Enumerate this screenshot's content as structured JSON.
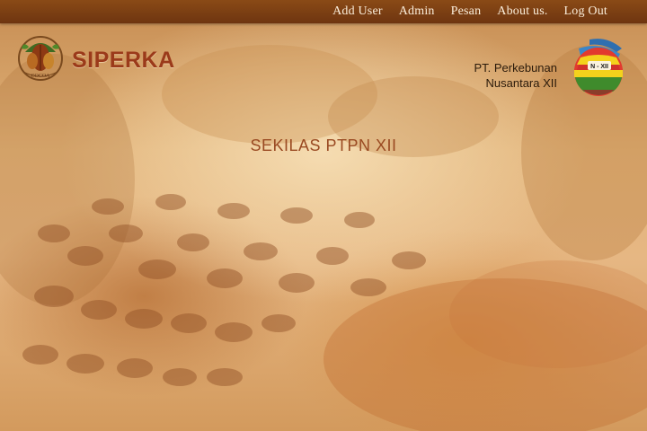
{
  "nav": {
    "items": [
      {
        "label": "Add User"
      },
      {
        "label": "Admin"
      },
      {
        "label": "Pesan"
      },
      {
        "label": "About us."
      },
      {
        "label": "Log Out"
      }
    ]
  },
  "brand": {
    "name": "SIPERKA",
    "logo_icon": "cocoa-logo-icon",
    "logo_text": "COCOA"
  },
  "company": {
    "line1": "PT. Perkebunan",
    "line2": "Nusantara XII",
    "logo_icon": "ptpn-logo-icon",
    "logo_text": "N - XII"
  },
  "page": {
    "title": "SEKILAS PTPN XII"
  },
  "colors": {
    "topbar": "#7a3d12",
    "brand": "#9b3a1a",
    "title": "#9a4a22",
    "nav_text": "#fbeedb"
  }
}
